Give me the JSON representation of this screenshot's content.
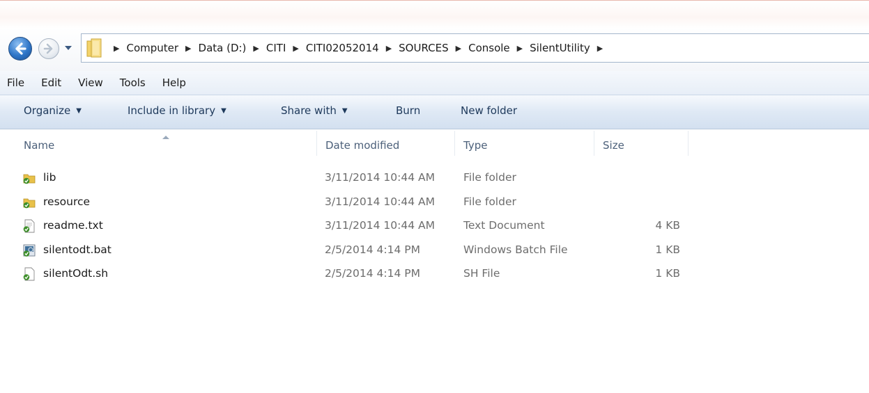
{
  "address_bar": {
    "breadcrumbs": [
      "Computer",
      "Data (D:)",
      "CITI",
      "CITI02052014",
      "SOURCES",
      "Console",
      "SilentUtility"
    ]
  },
  "menu": {
    "items": [
      "File",
      "Edit",
      "View",
      "Tools",
      "Help"
    ]
  },
  "command_bar": {
    "organize": "Organize",
    "include_in_library": "Include in library",
    "share_with": "Share with",
    "burn": "Burn",
    "new_folder": "New folder"
  },
  "columns": {
    "name": "Name",
    "date_modified": "Date modified",
    "type": "Type",
    "size": "Size"
  },
  "files": [
    {
      "icon": "folder-icon",
      "name": "lib",
      "date": "3/11/2014 10:44 AM",
      "type": "File folder",
      "size": ""
    },
    {
      "icon": "folder-icon",
      "name": "resource",
      "date": "3/11/2014 10:44 AM",
      "type": "File folder",
      "size": ""
    },
    {
      "icon": "text-file-icon",
      "name": "readme.txt",
      "date": "3/11/2014 10:44 AM",
      "type": "Text Document",
      "size": "4 KB"
    },
    {
      "icon": "batch-file-icon",
      "name": "silentodt.bat",
      "date": "2/5/2014 4:14 PM",
      "type": "Windows Batch File",
      "size": "1 KB"
    },
    {
      "icon": "sh-file-icon",
      "name": "silentOdt.sh",
      "date": "2/5/2014 4:14 PM",
      "type": "SH File",
      "size": "1 KB"
    }
  ],
  "colors": {
    "command_text": "#1e395b",
    "header_text": "#4c607a",
    "detail_text": "#6d6d6d",
    "folder_yellow": "#e8c14a",
    "check_green": "#3e8f2a"
  }
}
